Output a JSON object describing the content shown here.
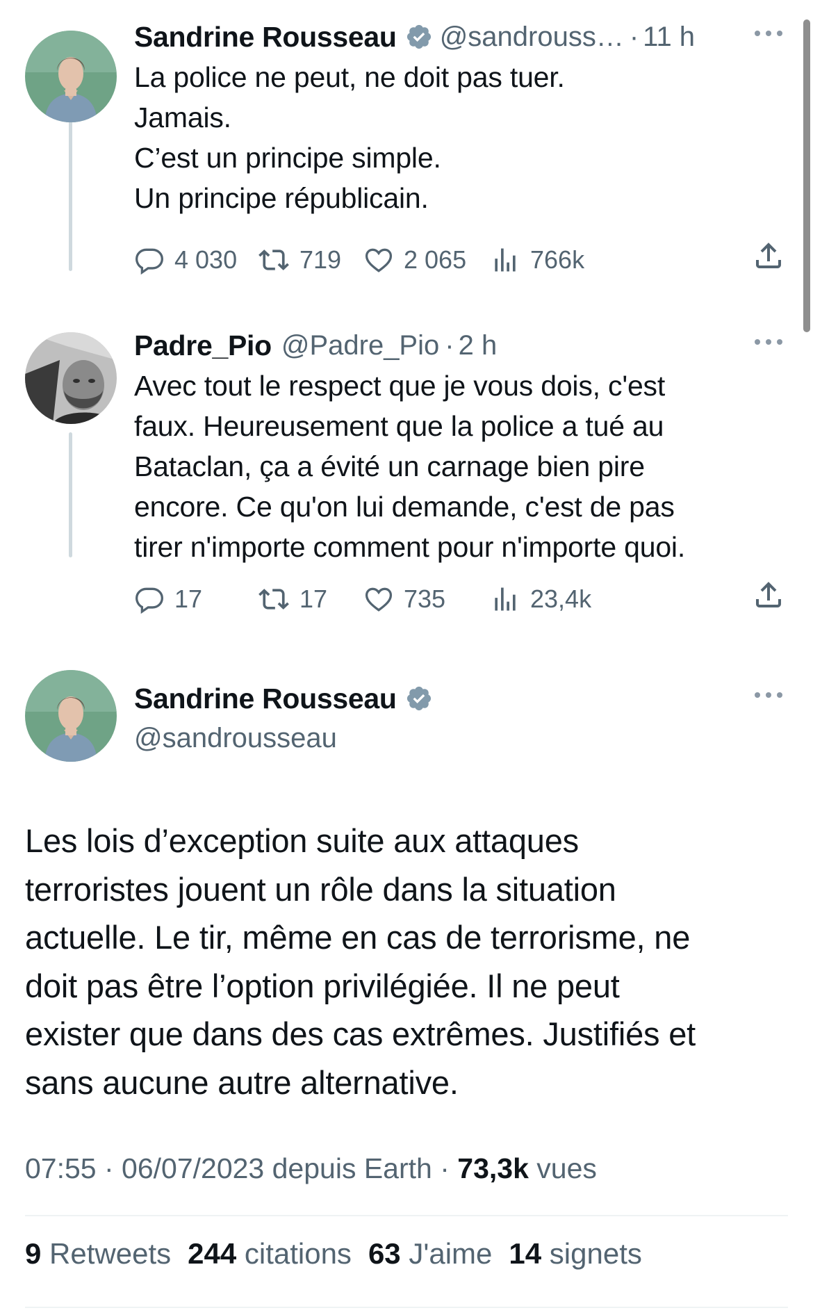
{
  "tweets": [
    {
      "name": "Sandrine Rousseau",
      "handle": "@sandrouss…",
      "separator": "·",
      "time": "11 h",
      "text": "La police ne peut, ne doit pas tuer.\nJamais.\nC’est un principe simple.\nUn principe républicain.",
      "replies": "4 030",
      "retweets": "719",
      "likes": "2 065",
      "views": "766k"
    },
    {
      "name": "Padre_Pio",
      "handle": "@Padre_Pio",
      "separator": "·",
      "time": "2 h",
      "text": "Avec tout le respect que je vous dois, c'est\nfaux. Heureusement que la police a tué au\nBataclan, ça a évité un carnage bien pire\nencore. Ce qu'on lui demande, c'est de pas\ntirer n'importe comment pour n'importe quoi.",
      "replies": "17",
      "retweets": "17",
      "likes": "735",
      "views": "23,4k"
    }
  ],
  "main": {
    "name": "Sandrine Rousseau",
    "handle": "@sandrousseau",
    "text": "Les lois d’exception suite aux attaques\nterroristes jouent un rôle dans la situation\nactuelle. Le tir, même en cas de terrorisme, ne\ndoit pas être l’option privilégiée. Il ne peut\nexister que dans des cas extrêmes. Justifiés et\nsans aucune autre alternative.",
    "timestamp": "07:55 · 06/07/2023 depuis Earth · ",
    "views_count": "73,3k",
    "views_label": " vues",
    "stats": {
      "retweets_count": "9",
      "retweets_label": "Retweets",
      "quotes_count": "244",
      "quotes_label": "citations",
      "likes_count": "63",
      "likes_label": "J'aime",
      "bookmarks_count": "14",
      "bookmarks_label": "signets"
    }
  },
  "colors": {
    "text": "#0f1419",
    "secondary": "#536471",
    "verified_badge": "#829aab",
    "thread_line": "#cfd9de",
    "divider": "#eff3f4"
  },
  "icons": [
    "verified-badge-icon",
    "more-icon",
    "reply-icon",
    "retweet-icon",
    "like-icon",
    "views-icon",
    "share-icon"
  ]
}
